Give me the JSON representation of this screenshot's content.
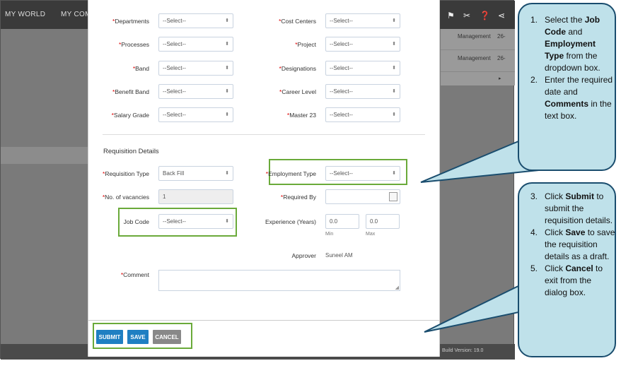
{
  "background_app": {
    "nav": [
      "MY WORLD",
      "MY COMPA"
    ],
    "right_rows": [
      {
        "col1": "Management",
        "col2": "26-"
      },
      {
        "col1": "Management",
        "col2": "26-"
      }
    ],
    "build_text": "Build Version: 19.0"
  },
  "form": {
    "departments": {
      "label": "Departments",
      "value": "--Select--"
    },
    "cost_centers": {
      "label": "Cost Centers",
      "value": "--Select--"
    },
    "processes": {
      "label": "Processes",
      "value": "--Select--"
    },
    "project": {
      "label": "Project",
      "value": "--Select--"
    },
    "band": {
      "label": "Band",
      "value": "--Select--"
    },
    "designations": {
      "label": "Designations",
      "value": "--Select--"
    },
    "benefit_band": {
      "label": "Benefit Band",
      "value": "--Select--"
    },
    "career_level": {
      "label": "Career Level",
      "value": "--Select--"
    },
    "salary_grade": {
      "label": "Salary Grade",
      "value": "--Select--"
    },
    "master23": {
      "label": "Master 23",
      "value": "--Select--"
    }
  },
  "requisition": {
    "section_title": "Requisition Details",
    "requisition_type": {
      "label": "Requisition Type",
      "value": "Back Fill"
    },
    "employment_type": {
      "label": "Employment Type",
      "value": "--Select--"
    },
    "no_of_vacancies": {
      "label": "No. of vacancies",
      "value": "1"
    },
    "required_by": {
      "label": "Required By",
      "value": ""
    },
    "job_code": {
      "label": "Job Code",
      "value": "--Select--"
    },
    "experience": {
      "label": "Experience (Years)",
      "min_value": "0.0",
      "max_value": "0.0",
      "min_label": "Min",
      "max_label": "Max"
    },
    "approver": {
      "label": "Approver",
      "value": "Suneel AM"
    },
    "comment": {
      "label": "Comment",
      "value": ""
    }
  },
  "buttons": {
    "submit": "SUBMIT",
    "save": "SAVE",
    "cancel": "CANCEL"
  },
  "callout_top": {
    "items": [
      {
        "num": "1.",
        "parts": [
          "Select the ",
          "Job Code",
          " and ",
          "Employment Type",
          " from the dropdown box."
        ]
      },
      {
        "num": "2.",
        "parts": [
          "Enter the required date and ",
          "Comments",
          " in the text box."
        ]
      }
    ]
  },
  "callout_bottom": {
    "items": [
      {
        "num": "3.",
        "parts": [
          "Click ",
          "Submit",
          " to submit the requisition details."
        ]
      },
      {
        "num": "4.",
        "parts": [
          "Click ",
          "Save",
          " to save the requisition details as a draft."
        ]
      },
      {
        "num": "5.",
        "parts": [
          "Click ",
          "Cancel",
          " to exit from the dialog box."
        ]
      }
    ]
  },
  "colors": {
    "highlight": "#6aaa3a",
    "button_blue": "#1f7fc2",
    "callout_fill": "#bfe1ea",
    "callout_border": "#1a4d6e"
  }
}
